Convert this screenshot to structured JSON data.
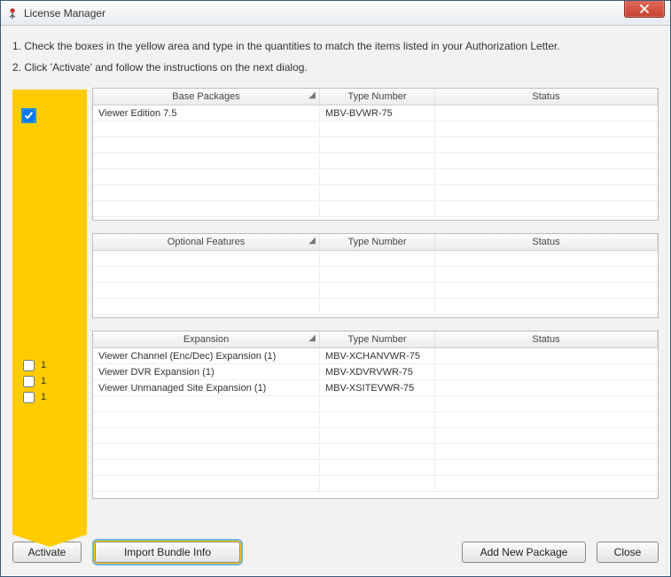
{
  "window": {
    "title": "License Manager"
  },
  "instructions": {
    "line1": "1. Check the boxes in the yellow area and type in the quantities to match the items listed in your Authorization Letter.",
    "line2": "2. Click 'Activate' and follow the instructions on the next dialog."
  },
  "tables": {
    "base": {
      "headers": {
        "col1": "Base Packages",
        "col2": "Type Number",
        "col3": "Status"
      },
      "rows": [
        {
          "checked": true,
          "qty": "",
          "name": "Viewer Edition 7.5",
          "type": "MBV-BVWR-75",
          "status": ""
        }
      ],
      "emptyRows": 7
    },
    "optional": {
      "headers": {
        "col1": "Optional Features",
        "col2": "Type Number",
        "col3": "Status"
      },
      "rows": [],
      "emptyRows": 4
    },
    "expansion": {
      "headers": {
        "col1": "Expansion",
        "col2": "Type Number",
        "col3": "Status"
      },
      "rows": [
        {
          "checked": false,
          "qty": "1",
          "name": "Viewer Channel (Enc/Dec) Expansion (1)",
          "type": "MBV-XCHANVWR-75",
          "status": ""
        },
        {
          "checked": false,
          "qty": "1",
          "name": "Viewer DVR Expansion (1)",
          "type": "MBV-XDVRVWR-75",
          "status": ""
        },
        {
          "checked": false,
          "qty": "1",
          "name": "Viewer Unmanaged Site Expansion (1)",
          "type": "MBV-XSITEVWR-75",
          "status": ""
        }
      ],
      "emptyRows": 7
    }
  },
  "buttons": {
    "activate": "Activate",
    "import": "Import Bundle Info",
    "addnew": "Add New Package",
    "close": "Close"
  }
}
